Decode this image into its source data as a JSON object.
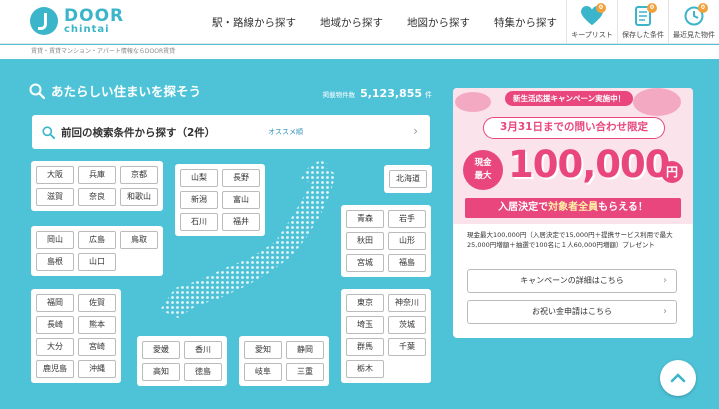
{
  "header": {
    "logo_line1": "DOOR",
    "logo_line2": "chintai",
    "nav": [
      "駅・路線から探す",
      "地域から探す",
      "地図から探す",
      "特集から探す"
    ],
    "icons": [
      {
        "name": "heart-icon",
        "label": "キープリスト",
        "badge": "0"
      },
      {
        "name": "document-icon",
        "label": "保存した条件",
        "badge": "0"
      },
      {
        "name": "clock-icon",
        "label": "最近見た物件",
        "badge": "0"
      }
    ]
  },
  "breadcrumb": "賃貸・賃貸マンション・アパート情報ならDOOR賃貸",
  "search": {
    "title": "あたらしい住まいを探そう",
    "count_label": "掲載物件数",
    "count_value": "5,123,855",
    "count_unit": "件",
    "previous_label": "前回の検索条件から探す（2件）",
    "recommend": "オススメ順"
  },
  "regions": {
    "kinki": [
      "大阪",
      "兵庫",
      "京都",
      "滋賀",
      "奈良",
      "和歌山"
    ],
    "chugoku": [
      "岡山",
      "広島",
      "鳥取",
      "島根",
      "山口"
    ],
    "kyushu": [
      "福岡",
      "佐賀",
      "長崎",
      "熊本",
      "大分",
      "宮崎",
      "鹿児島",
      "沖縄"
    ],
    "koshinetsu": [
      "山梨",
      "長野",
      "新潟",
      "富山",
      "石川",
      "福井"
    ],
    "shikoku": [
      "愛媛",
      "香川",
      "高知",
      "徳島"
    ],
    "tokai": [
      "愛知",
      "静岡",
      "岐阜",
      "三重"
    ],
    "hokkaido": [
      "北海道"
    ],
    "tohoku": [
      "青森",
      "岩手",
      "秋田",
      "山形",
      "宮城",
      "福島"
    ],
    "kanto": [
      "東京",
      "神奈川",
      "埼玉",
      "茨城",
      "群馬",
      "千葉",
      "栃木"
    ]
  },
  "campaign": {
    "banner": "新生活応援キャンペーン実施中！",
    "date_line": "3月31日までの問い合わせ限定",
    "circle_line1": "現金",
    "circle_line2": "最大",
    "amount": "100,000",
    "yen": "円",
    "strip_pre": "入居決定で",
    "strip_hl": "対象者全員",
    "strip_post": "もらえる！",
    "desc": "現金最大100,000円（入居決定で15,000円＋提携サービス利用で最大25,000円増額＋抽選で100名に１人60,000円増額）プレゼント",
    "btn_detail": "キャンペーンの詳細はこちら",
    "btn_apply": "お祝い金申請はこちら"
  },
  "colors": {
    "accent": "#3ab5c9",
    "background": "#4ec3d8",
    "campaign": "#e8467c"
  }
}
